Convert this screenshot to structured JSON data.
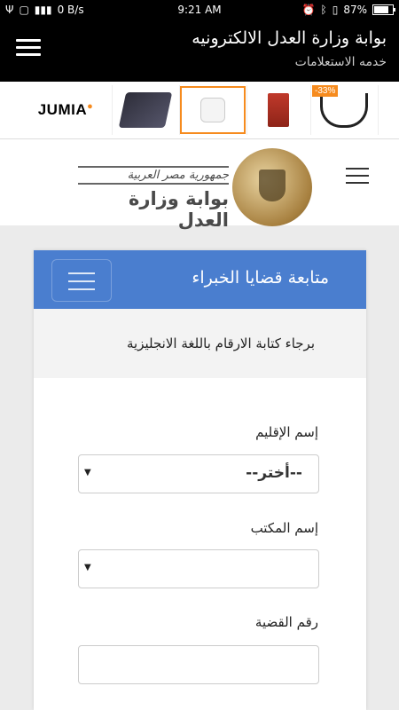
{
  "status_bar": {
    "net_speed": "0 B/s",
    "time": "9:21 AM",
    "battery": "87%"
  },
  "app_bar": {
    "title": "بوابة وزارة العدل الالكترونيه",
    "subtitle": "خدمه الاستعلامات"
  },
  "ad": {
    "brand": "JUMIA",
    "discount": "-33%"
  },
  "site_header": {
    "logo_line1": "جمهورية مصر العربية",
    "logo_line2": "بوابة وزارة العدل"
  },
  "card": {
    "title": "متابعة قضايا الخبراء",
    "note": "برجاء كتابة الارقام باللغة الانجليزية",
    "region_label": "إسم الإقليم",
    "region_value": "--أختر--",
    "office_label": "إسم المكتب",
    "office_value": "",
    "case_label": "رقم القضية",
    "case_value": ""
  }
}
